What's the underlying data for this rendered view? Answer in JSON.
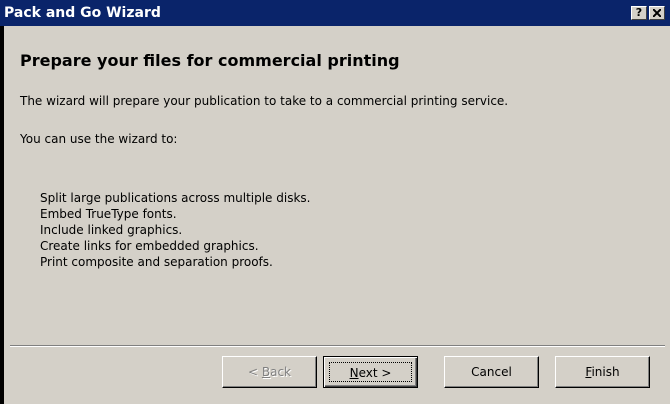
{
  "window": {
    "title": "Pack and Go Wizard",
    "help_label": "?"
  },
  "content": {
    "heading": "Prepare your files for commercial printing",
    "intro": "The wizard will prepare your publication to take to a commercial printing service.",
    "you_can": "You can use the wizard to:",
    "features": [
      "Split large publications across multiple disks.",
      "Embed TrueType fonts.",
      "Include linked graphics.",
      "Create links for embedded graphics.",
      "Print composite and separation proofs."
    ]
  },
  "buttons": {
    "back": {
      "prefix": "< ",
      "mnemonic": "B",
      "rest": "ack",
      "enabled": false
    },
    "next": {
      "mnemonic": "N",
      "rest": "ext >",
      "default": true
    },
    "cancel": {
      "label": "Cancel"
    },
    "finish": {
      "mnemonic": "F",
      "rest": "inish"
    }
  },
  "colors": {
    "title_bar": "#0a246a",
    "face": "#d4d0c8",
    "disabled_text": "#808080"
  }
}
